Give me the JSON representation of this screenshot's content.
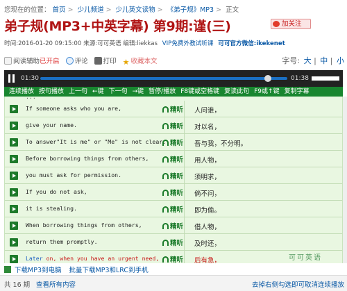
{
  "breadcrumb": {
    "prefix": "您现在的位置：",
    "items": [
      "首页",
      "少儿频道",
      "少儿英文读物",
      "《弟子规》MP3",
      "正文"
    ],
    "separator": ">"
  },
  "title": "弟子规(MP3+中英字幕) 第9期:谨(三)",
  "follow_label": "加关注",
  "meta": {
    "time": "时间:2016-01-20 09:15:00",
    "source": "来源:可可英语",
    "editor": "编辑:liekkas",
    "vip": "VIP免费外教试听课",
    "weixin": "可可官方微信:ikekenet"
  },
  "tools": {
    "reader": "阅读辅助",
    "reader_state": "已开启",
    "comment": "评论",
    "print": "打印",
    "favorite": "收藏本文"
  },
  "font_size": {
    "label": "字号:",
    "options": [
      "大",
      "中",
      "小"
    ]
  },
  "player": {
    "current_time": "01:30",
    "total_time": "01:38",
    "progress": 0.92,
    "accent": "#1a70c4"
  },
  "controls": [
    "连续播放",
    "按句播放",
    "上一句",
    "←键",
    "下一句",
    "→键",
    "暂停/播放",
    "F8键或空格键",
    "复读此句",
    "F9或↑键",
    "复制字幕"
  ],
  "listen_label": "精听",
  "partial_line": "...",
  "rows": [
    {
      "en": "If someone asks who you are,",
      "zh": "人问谁，"
    },
    {
      "en": "give your name.",
      "zh": "对以名，"
    },
    {
      "en": "To answer\"It is me\" or \"Me\" is not clear.",
      "zh": "吾与我，不分明。"
    },
    {
      "en": "Before borrowing things from others,",
      "zh": "用人物，"
    },
    {
      "en": "you must ask for permission.",
      "zh": "须明求，"
    },
    {
      "en": "If you do not ask,",
      "zh": "倘不问，"
    },
    {
      "en": "it is stealing.",
      "zh": "即为偷。"
    },
    {
      "en": "When borrowing things from others,",
      "zh": "借人物，"
    },
    {
      "en": "return them promptly.",
      "zh": "及时还，"
    },
    {
      "en_first": "Later",
      "en_rest": " on, when you have an urgent need,",
      "zh": "后有急，"
    }
  ],
  "watermark": "可可英语",
  "download": {
    "mp3": "下载MP3到电脑",
    "batch": "批量下载MP3和LRC到手机"
  },
  "footer": {
    "count": "共 16 期",
    "all": "查看所有内容",
    "hint": "去掉右侧勾选即可取消连续播放"
  },
  "colors": {
    "title": "#b01414",
    "control_bar": "#18862f",
    "list_bg": "#e9f7e1",
    "active_text": "#c81818"
  }
}
